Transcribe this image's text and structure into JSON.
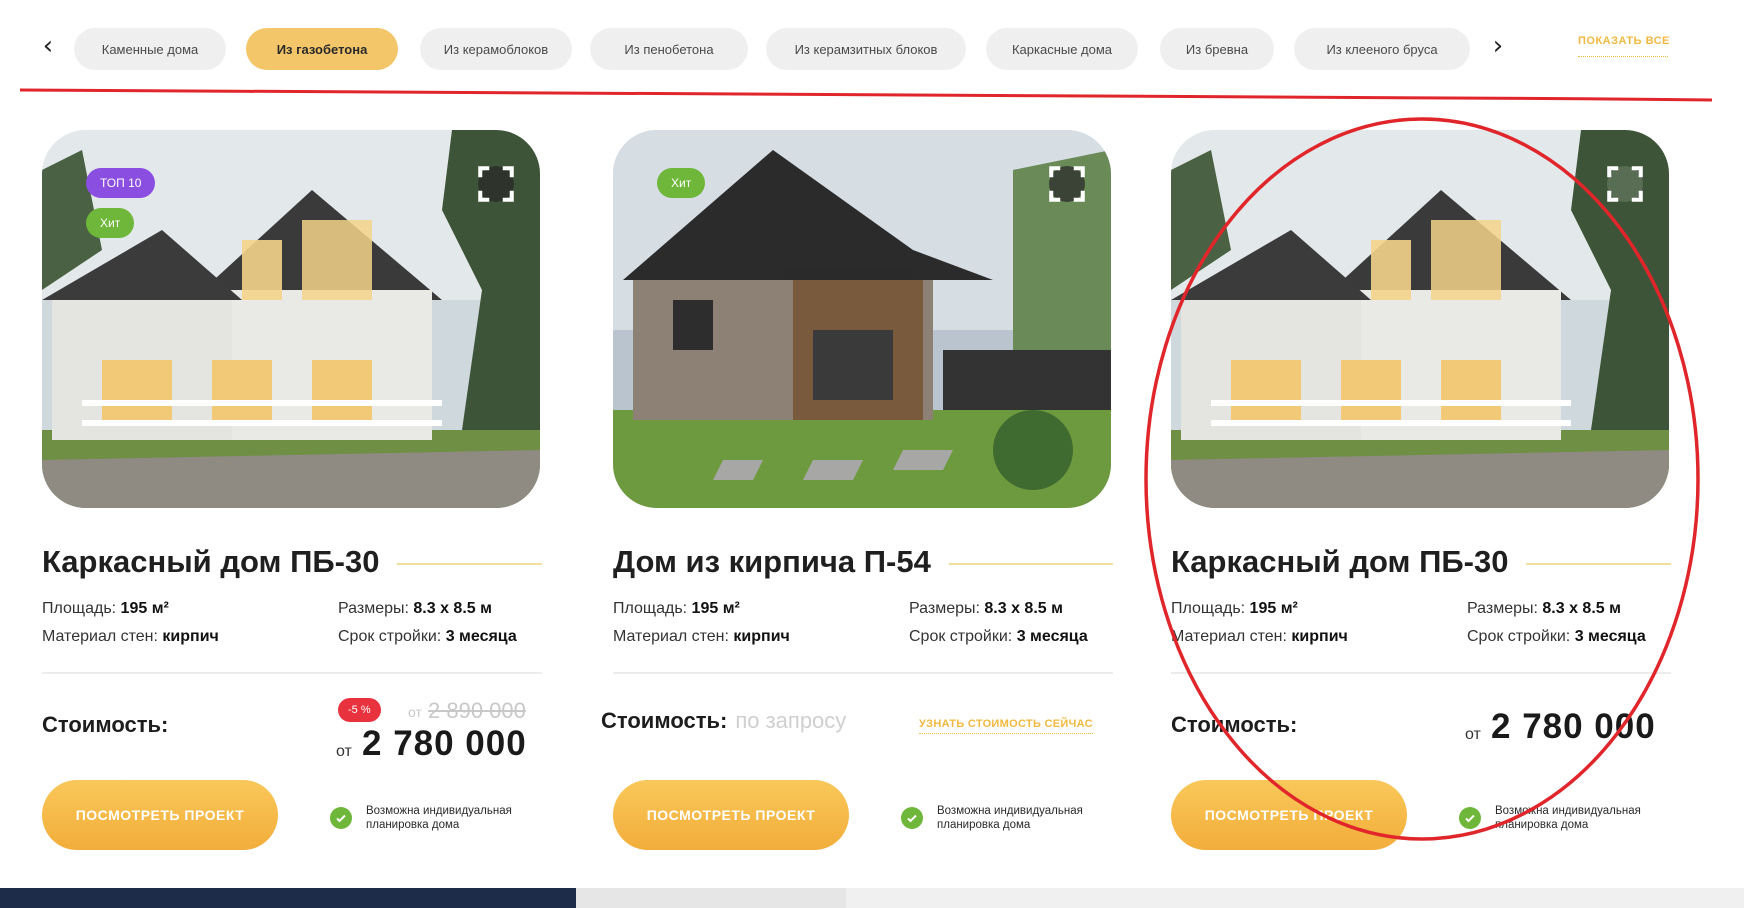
{
  "filters": {
    "prev_icon": "chevron-left-icon",
    "next_icon": "chevron-right-icon",
    "items": [
      {
        "label": "Каменные дома",
        "active": false
      },
      {
        "label": "Из газобетона",
        "active": true
      },
      {
        "label": "Из керамоблоков",
        "active": false
      },
      {
        "label": "Из пенобетона",
        "active": false
      },
      {
        "label": "Из керамзитных блоков",
        "active": false
      },
      {
        "label": "Каркасные дома",
        "active": false
      },
      {
        "label": "Из бревна",
        "active": false
      },
      {
        "label": "Из клееного бруса",
        "active": false
      }
    ],
    "show_all": "ПОКАЗАТЬ ВСЕ"
  },
  "cards": [
    {
      "badges": [
        "ТОП 10",
        "Хит"
      ],
      "title": "Каркасный дом ПБ-30",
      "area_label": "Площадь:",
      "area_value": "195 м²",
      "size_label": "Размеры:",
      "size_value": "8.3 х 8.5 м",
      "material_label": "Материал стен:",
      "material_value": "кирпич",
      "term_label": "Срок стройки:",
      "term_value": "3 месяца",
      "price_label": "Стоимость:",
      "discount": "-5 %",
      "old_prefix": "от",
      "old_price": "2 890 000",
      "price_prefix": "от",
      "price": "2 780 000",
      "button": "ПОСМОТРЕТЬ ПРОЕКТ",
      "note": "Возможна индивидуальная планировка дома"
    },
    {
      "badges": [
        "Хит"
      ],
      "title": "Дом из кирпича П-54",
      "area_label": "Площадь:",
      "area_value": "195 м²",
      "size_label": "Размеры:",
      "size_value": "8.3 х 8.5 м",
      "material_label": "Материал стен:",
      "material_value": "кирпич",
      "term_label": "Срок стройки:",
      "term_value": "3 месяца",
      "price_label": "Стоимость:",
      "on_request": "по запросу",
      "ask_link": "УЗНАТЬ СТОИМОСТЬ СЕЙЧАС",
      "button": "ПОСМОТРЕТЬ ПРОЕКТ",
      "note": "Возможна индивидуальная планировка дома"
    },
    {
      "badges": [],
      "title": "Каркасный дом ПБ-30",
      "area_label": "Площадь:",
      "area_value": "195 м²",
      "size_label": "Размеры:",
      "size_value": "8.3 х 8.5 м",
      "material_label": "Материал стен:",
      "material_value": "кирпич",
      "term_label": "Срок стройки:",
      "term_value": "3 месяца",
      "price_label": "Стоимость:",
      "price_prefix": "от",
      "price": "2 780 000",
      "button": "ПОСМОТРЕТЬ ПРОЕКТ",
      "note": "Возможна индивидуальная планировка дома"
    }
  ],
  "colors": {
    "accent": "#f2b544",
    "active_chip": "#f3c66a",
    "badge_top": "#8a4fe0",
    "badge_hit": "#6eb73a",
    "discount": "#e8333f",
    "annotation": "#e0262b"
  }
}
